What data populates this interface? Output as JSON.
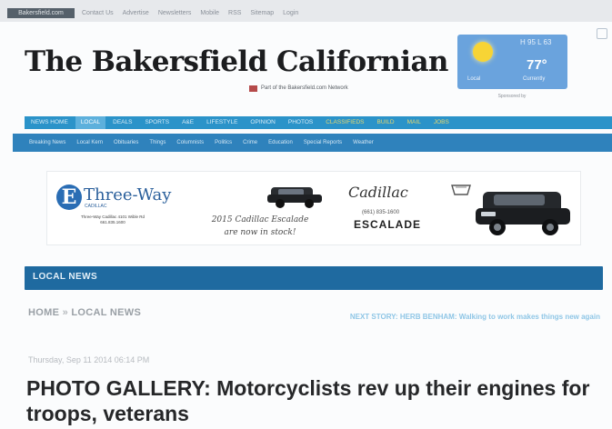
{
  "topbar": {
    "home_label": "Bakersfield.com",
    "links": [
      "Contact Us",
      "Advertise",
      "Newsletters",
      "Mobile",
      "RSS",
      "Sitemap",
      "Login"
    ]
  },
  "masthead": {
    "title": "The Bakersfield Californian",
    "tagline": "Part of the Bakersfield.com Network"
  },
  "weather": {
    "temp": "77°",
    "hilo": "H 95 L 63",
    "location": "Local",
    "current": "Currently",
    "sponsor": "Sponsored by"
  },
  "primary_nav": {
    "items": [
      {
        "label": "NEWS HOME",
        "state": "normal"
      },
      {
        "label": "LOCAL",
        "state": "active"
      },
      {
        "label": "DEALS",
        "state": "normal"
      },
      {
        "label": "SPORTS",
        "state": "normal"
      },
      {
        "label": "A&E",
        "state": "normal"
      },
      {
        "label": "LIFESTYLE",
        "state": "normal"
      },
      {
        "label": "OPINION",
        "state": "normal"
      },
      {
        "label": "PHOTOS",
        "state": "normal"
      },
      {
        "label": "CLASSIFIEDS",
        "state": "yellow"
      },
      {
        "label": "BUILD",
        "state": "yellow"
      },
      {
        "label": "MAIL",
        "state": "yellow"
      },
      {
        "label": "JOBS",
        "state": "yellow"
      }
    ]
  },
  "secondary_nav": {
    "items": [
      "Breaking News",
      "Local Kern",
      "Obituaries",
      "Things",
      "Columnists",
      "Politics",
      "Crime",
      "Education",
      "Special Reports",
      "Weather"
    ]
  },
  "ad": {
    "logo_letter": "E",
    "logo_text": "Three-Way",
    "logo_sub": "CADILLAC",
    "dealer_info": "Three-Way Cadillac 4101 Wible Rd 661.835.1600",
    "caption_line1": "2015 Cadillac Escalade",
    "caption_line2": "are now in stock!",
    "brand_script": "Cadillac",
    "phone": "(661) 835-1600",
    "model": "ESCALADE"
  },
  "section_bar": {
    "label": "LOCAL NEWS"
  },
  "breadcrumb": {
    "home": "HOME",
    "separator": "»",
    "section": "LOCAL NEWS"
  },
  "next_story": "NEXT STORY: HERB BENHAM: Walking to work makes things new again",
  "article": {
    "dateline": "Thursday, Sep 11 2014 06:14 PM",
    "headline": "PHOTO GALLERY: Motorcyclists rev up their engines for troops, veterans"
  },
  "colors": {
    "nav_primary": "#2b93c9",
    "nav_secondary": "#2f82bc",
    "section_bar": "#1f6aa0",
    "weather_bg": "#6aa3dd",
    "accent_yellow": "#e7d86e"
  }
}
